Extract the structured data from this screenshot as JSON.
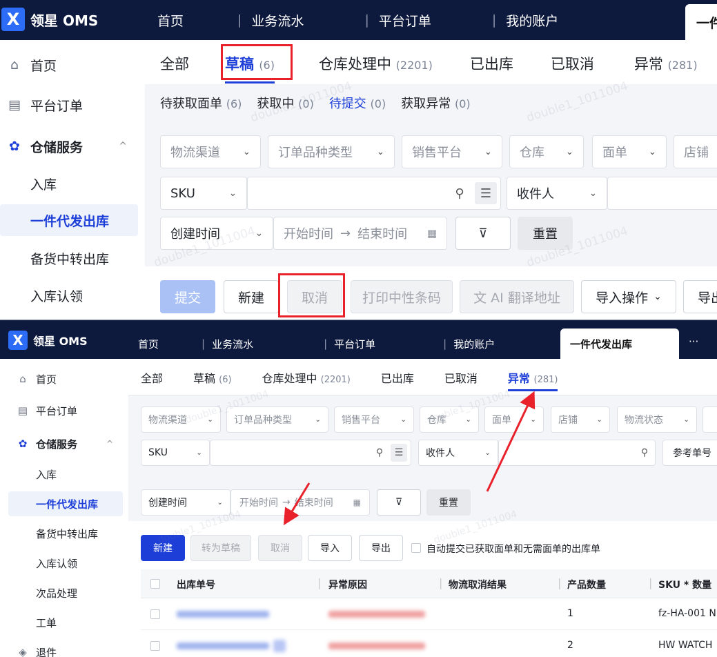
{
  "app": {
    "name": "领星 OMS",
    "logo_mark": "X"
  },
  "header": {
    "nav": [
      "首页",
      "业务流水",
      "平台订单",
      "我的账户"
    ],
    "active_tab": "一件代发出库",
    "active_tab_partial": "一件",
    "more": "···"
  },
  "sidebar": {
    "items": [
      {
        "label": "首页",
        "icon": "home-icon"
      },
      {
        "label": "平台订单",
        "icon": "clipboard-icon"
      },
      {
        "label": "仓储服务",
        "icon": "warehouse-icon",
        "expand": "^"
      },
      {
        "label": "入库"
      },
      {
        "label": "一件代发出库"
      },
      {
        "label": "备货中转出库"
      },
      {
        "label": "入库认领"
      },
      {
        "label": "次品处理"
      },
      {
        "label": "工单"
      },
      {
        "label": "退件",
        "icon": "return-icon"
      }
    ]
  },
  "tabs": [
    {
      "label": "全部",
      "count": ""
    },
    {
      "label": "草稿",
      "count": "(6)"
    },
    {
      "label": "仓库处理中",
      "count": "(2201)"
    },
    {
      "label": "已出库",
      "count": ""
    },
    {
      "label": "已取消",
      "count": ""
    },
    {
      "label": "异常",
      "count": "(281)"
    }
  ],
  "subtabs": [
    {
      "label": "待获取面单",
      "count": "(6)"
    },
    {
      "label": "获取中",
      "count": "(0)"
    },
    {
      "label": "待提交",
      "count": "(0)"
    },
    {
      "label": "获取异常",
      "count": "(0)"
    }
  ],
  "filters": {
    "selects": [
      "物流渠道",
      "订单品种类型",
      "销售平台",
      "仓库",
      "面单",
      "店铺",
      "物流状态"
    ],
    "sku_select": "SKU",
    "receiver_select": "收件人",
    "ref_select": "参考单号",
    "time_select": "创建时间",
    "start_time": "开始时间",
    "end_time": "结束时间",
    "arrow": "→",
    "reset": "重置"
  },
  "actions_top": {
    "submit": "提交",
    "new": "新建",
    "cancel": "取消",
    "print": "打印中性条码",
    "ai": "AI 翻译地址",
    "import_ops": "导入操作",
    "export_partial": "导出"
  },
  "actions_bottom": {
    "new": "新建",
    "to_draft": "转为草稿",
    "cancel": "取消",
    "import": "导入",
    "export": "导出",
    "auto_submit": "自动提交已获取面单和无需面单的出库单"
  },
  "table": {
    "headers": [
      "出库单号",
      "异常原因",
      "物流取消结果",
      "产品数量",
      "SKU * 数量"
    ],
    "rows": [
      {
        "qty": "1",
        "sku": "fz-HA-001 N"
      },
      {
        "qty": "2",
        "sku": "HW WATCH"
      }
    ]
  },
  "watermark": "double1_1011004",
  "colors": {
    "header_bg": "#0e1a3d",
    "primary": "#1d3fd8",
    "highlight_red": "#e8212a"
  }
}
